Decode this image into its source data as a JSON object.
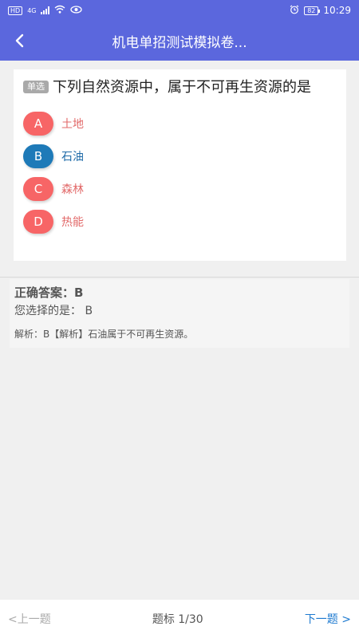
{
  "status_bar": {
    "hd_label": "HD",
    "network_label": "4G",
    "battery": "82",
    "time": "10:29"
  },
  "header": {
    "title": "机电单招测试模拟卷..."
  },
  "question": {
    "type_badge": "单选",
    "text": "下列自然资源中，属于不可再生资源的是",
    "options": [
      {
        "letter": "A",
        "text": "土地"
      },
      {
        "letter": "B",
        "text": "石油"
      },
      {
        "letter": "C",
        "text": "森林"
      },
      {
        "letter": "D",
        "text": "热能"
      }
    ]
  },
  "answer": {
    "correct": "正确答案：B",
    "your_choice": "您选择的是：  B",
    "analysis": "解析：B【解析】石油属于不可再生资源。"
  },
  "nav": {
    "prev": "<上一题",
    "page": "题标 1/30",
    "next": "下一题 >"
  },
  "colors": {
    "header_bg": "#5b67dd",
    "option_default": "#f76566",
    "option_selected": "#1e7ab8",
    "next_link": "#1e7ad0"
  }
}
